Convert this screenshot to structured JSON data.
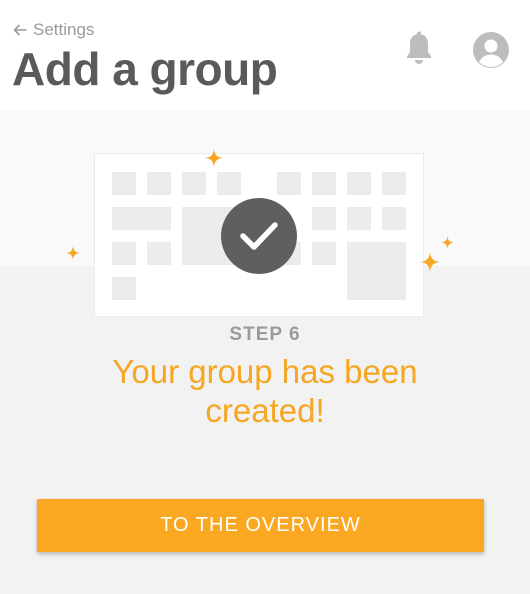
{
  "header": {
    "back_label": "Settings",
    "title": "Add a group",
    "icons": {
      "back": "arrow-left-icon",
      "notifications": "bell-icon",
      "profile": "user-avatar-icon"
    }
  },
  "illustration": {
    "icons": {
      "status": "checkmark-icon",
      "decor": "sparkle-icon"
    }
  },
  "wizard": {
    "step_label": "STEP 6",
    "message": "Your group has been created!"
  },
  "actions": {
    "overview_label": "TO THE OVERVIEW"
  },
  "colors": {
    "accent": "#f5a623",
    "button": "#faa822",
    "title": "#5a5a5a",
    "muted": "#9a9a9a",
    "check_bg": "#5f5f5f"
  }
}
